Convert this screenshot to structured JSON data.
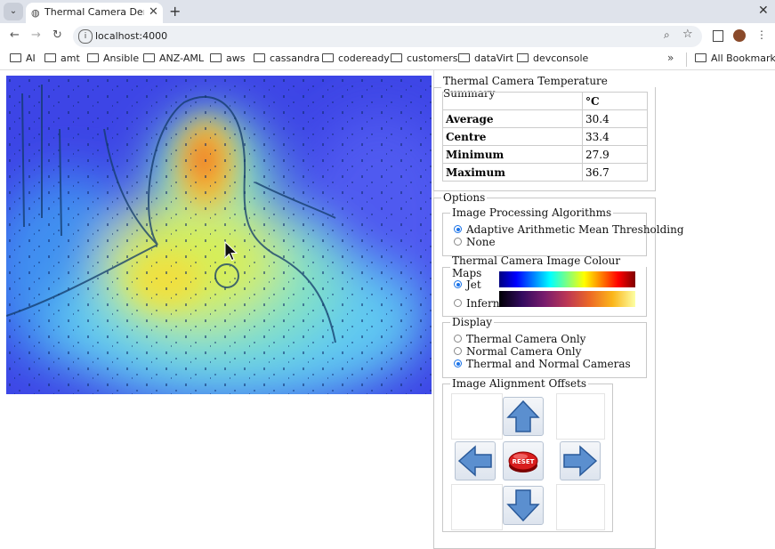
{
  "browser": {
    "tab_title": "Thermal Camera Demon",
    "url": "localhost:4000",
    "bookmarks": [
      "AI",
      "amt",
      "Ansible",
      "ANZ-AML",
      "aws",
      "cassandra",
      "codeready",
      "customers",
      "dataVirt",
      "devconsole"
    ],
    "all_bookmarks": "All Bookmarks",
    "more": "»"
  },
  "summary": {
    "legend": "Thermal Camera Temperature Summary",
    "unit": "°C",
    "rows": [
      {
        "label": "Average",
        "value": "30.4"
      },
      {
        "label": "Centre",
        "value": "33.4"
      },
      {
        "label": "Minimum",
        "value": "27.9"
      },
      {
        "label": "Maximum",
        "value": "36.7"
      }
    ]
  },
  "options": {
    "legend": "Options",
    "algorithms": {
      "legend": "Image Processing Algorithms",
      "items": [
        {
          "label": "Adaptive Arithmetic Mean Thresholding",
          "selected": true
        },
        {
          "label": "None",
          "selected": false
        }
      ]
    },
    "colour_maps": {
      "legend": "Thermal Camera Image Colour Maps",
      "items": [
        {
          "label": "Jet",
          "selected": true
        },
        {
          "label": "Inferno",
          "selected": false
        }
      ]
    },
    "display": {
      "legend": "Display",
      "items": [
        {
          "label": "Thermal Camera Only",
          "selected": false
        },
        {
          "label": "Normal Camera Only",
          "selected": false
        },
        {
          "label": "Thermal and Normal Cameras",
          "selected": true
        }
      ]
    },
    "alignment": {
      "legend": "Image Alignment Offsets",
      "reset_label": "RESET"
    }
  }
}
